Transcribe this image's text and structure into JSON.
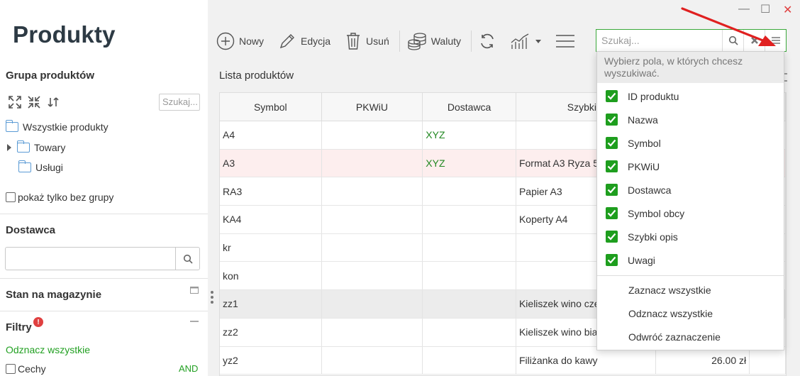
{
  "app": {
    "title": "Produkty"
  },
  "window": {
    "minimize": "—",
    "maximize": "☐",
    "close": "✕",
    "close_color": "#e04040"
  },
  "sidebar": {
    "group_title": "Grupa produktów",
    "tree_search_placeholder": "Szukaj...",
    "tree": [
      {
        "label": "Wszystkie produkty"
      },
      {
        "label": "Towary"
      },
      {
        "label": "Usługi"
      }
    ],
    "only_without_group": "pokaż tylko bez grupy",
    "supplier_title": "Dostawca",
    "stock_title": "Stan na magazynie",
    "filters_title": "Filtry",
    "filters_badge": "!",
    "select_all": "Odznacz wszystkie",
    "features": "Cechy",
    "and": "AND"
  },
  "toolbar": {
    "new": "Nowy",
    "edit": "Edycja",
    "delete": "Usuń",
    "currencies": "Waluty",
    "search_placeholder": "Szukaj..."
  },
  "list": {
    "title": "Lista produktów",
    "columns": [
      "Symbol",
      "PKWiU",
      "Dostawca",
      "Szybki o"
    ],
    "rows": [
      {
        "symbol": "A4",
        "pkwiu": "",
        "supplier": "XYZ",
        "desc": "",
        "price": ""
      },
      {
        "symbol": "A3",
        "pkwiu": "",
        "supplier": "XYZ",
        "desc": "Format A3 Ryza 5",
        "price": ""
      },
      {
        "symbol": "RA3",
        "pkwiu": "",
        "supplier": "",
        "desc": "Papier A3",
        "price": ""
      },
      {
        "symbol": "KA4",
        "pkwiu": "",
        "supplier": "",
        "desc": "Koperty A4",
        "price": ""
      },
      {
        "symbol": "kr",
        "pkwiu": "",
        "supplier": "",
        "desc": "",
        "price": ""
      },
      {
        "symbol": "kon",
        "pkwiu": "",
        "supplier": "",
        "desc": "",
        "price": ""
      },
      {
        "symbol": "zz1",
        "pkwiu": "",
        "supplier": "",
        "desc": "Kieliszek wino cze",
        "price": ""
      },
      {
        "symbol": "zz2",
        "pkwiu": "",
        "supplier": "",
        "desc": "Kieliszek wino bia",
        "price": ""
      },
      {
        "symbol": "yz2",
        "pkwiu": "",
        "supplier": "",
        "desc": "Filiżanka do kawy",
        "price": "26.00 zł"
      }
    ]
  },
  "dropdown": {
    "header": "Wybierz pola, w których chcesz wyszukiwać.",
    "fields": [
      "ID produktu",
      "Nazwa",
      "Symbol",
      "PKWiU",
      "Dostawca",
      "Symbol obcy",
      "Szybki opis",
      "Uwagi"
    ],
    "actions": [
      "Zaznacz wszystkie",
      "Odznacz wszystkie",
      "Odwróć zaznaczenie"
    ],
    "check_color": "#1e9e1e"
  }
}
